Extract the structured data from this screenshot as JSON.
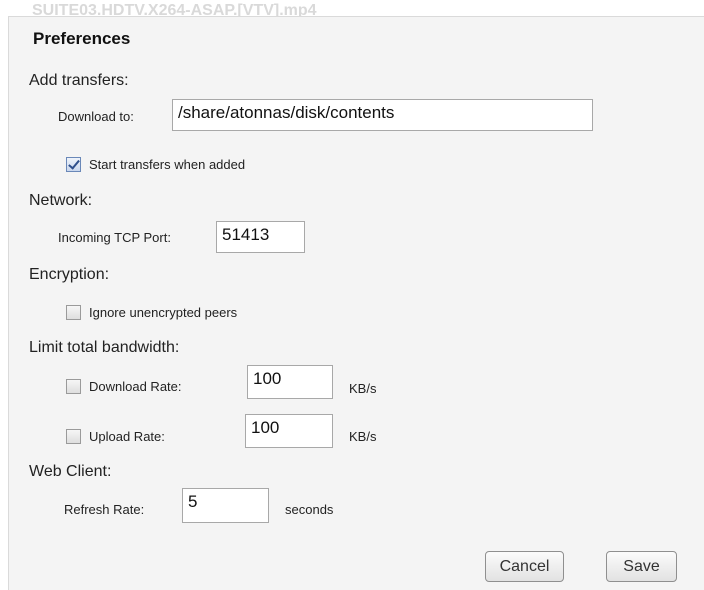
{
  "background": {
    "title": "SUITE03.HDTV.X264-ASAP.[VTV].mp4"
  },
  "dialog": {
    "title": "Preferences"
  },
  "add_transfers": {
    "heading": "Add transfers:",
    "download_to_label": "Download to:",
    "download_to_value": "/share/atonnas/disk/contents",
    "start_when_added_label": "Start transfers when added",
    "start_when_added_checked": true
  },
  "network": {
    "heading": "Network:",
    "port_label": "Incoming TCP Port:",
    "port_value": "51413"
  },
  "encryption": {
    "heading": "Encryption:",
    "ignore_unencrypted_label": "Ignore unencrypted peers",
    "ignore_unencrypted_checked": false
  },
  "bandwidth": {
    "heading": "Limit total bandwidth:",
    "download_rate_label": "Download Rate:",
    "download_rate_value": "100",
    "download_rate_unit": "KB/s",
    "download_rate_checked": false,
    "upload_rate_label": "Upload Rate:",
    "upload_rate_value": "100",
    "upload_rate_unit": "KB/s",
    "upload_rate_checked": false
  },
  "web_client": {
    "heading": "Web Client:",
    "refresh_rate_label": "Refresh Rate:",
    "refresh_rate_value": "5",
    "refresh_rate_unit": "seconds"
  },
  "buttons": {
    "cancel": "Cancel",
    "save": "Save"
  }
}
